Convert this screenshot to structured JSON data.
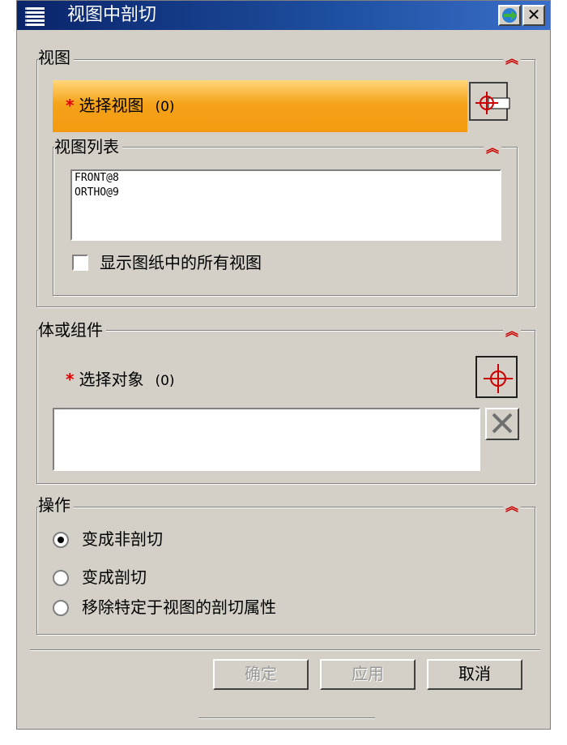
{
  "window": {
    "title": "视图中剖切",
    "help_icon": "help-arrow-icon",
    "close_label": "✕"
  },
  "view_group": {
    "title": "视图",
    "collapse_icon": "double-chevron-up-icon",
    "select_label": "选择视图",
    "select_count": "(0)",
    "highlight_color": "#f5a31a",
    "list": {
      "title": "视图列表",
      "items": [
        "FRONT@8",
        "ORTHO@9"
      ],
      "show_all_label": "显示图纸中的所有视图",
      "show_all_checked": false
    }
  },
  "body_group": {
    "title": "体或组件",
    "select_label": "选择对象",
    "select_count": "(0)"
  },
  "operation_group": {
    "title": "操作",
    "options": [
      "变成非剖切",
      "变成剖切",
      "移除特定于视图的剖切属性"
    ],
    "selected_index": 0
  },
  "buttons": {
    "ok": "确定",
    "apply": "应用",
    "cancel": "取消"
  }
}
